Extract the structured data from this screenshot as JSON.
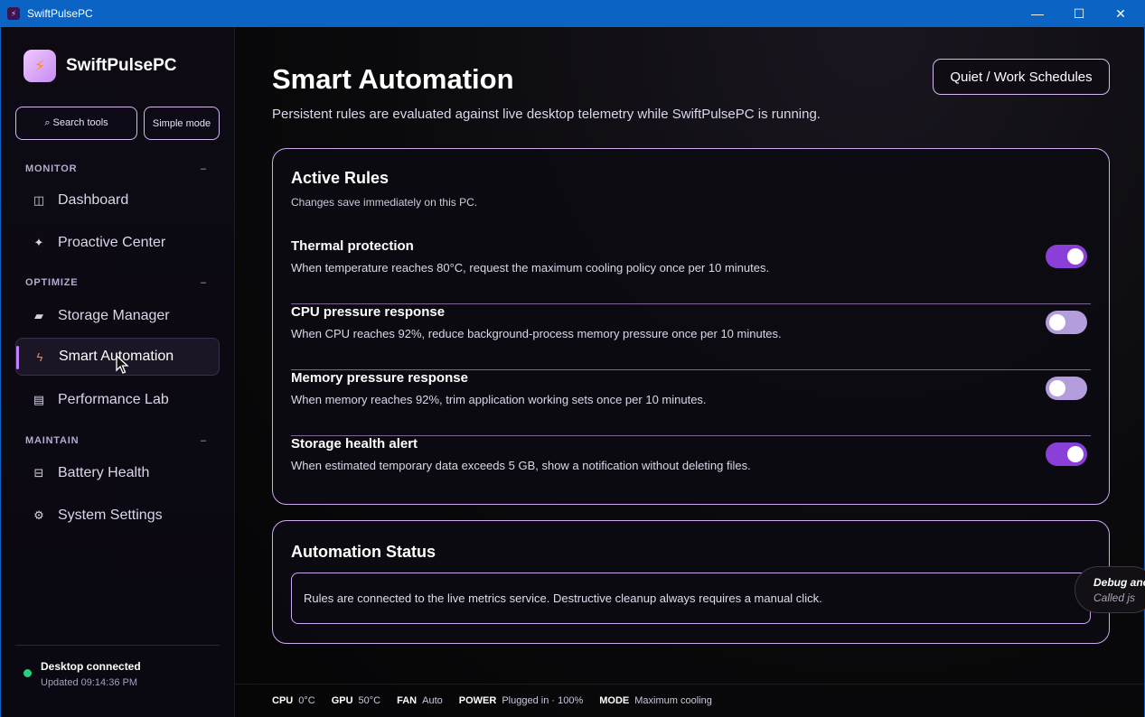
{
  "window": {
    "title": "SwiftPulsePC",
    "app_icon": "app-icon",
    "minimize_glyph": "—",
    "maximize_glyph": "☐",
    "close_glyph": "✕"
  },
  "sidebar": {
    "brand_name": "SwiftPulsePC",
    "brand_icon": "⚡",
    "search_label": "⌕ Search tools",
    "simple_mode_label": "Simple mode",
    "sections": [
      {
        "label": "MONITOR",
        "collapse": "–"
      },
      {
        "label": "OPTIMIZE",
        "collapse": "–"
      },
      {
        "label": "MAINTAIN",
        "collapse": "–"
      }
    ],
    "items": [
      {
        "label": "Dashboard",
        "icon": "◫"
      },
      {
        "label": "Proactive Center",
        "icon": "✦"
      },
      {
        "label": "Storage Manager",
        "icon": "▰"
      },
      {
        "label": "Smart Automation",
        "icon": "ϟ"
      },
      {
        "label": "Performance Lab",
        "icon": "▤"
      },
      {
        "label": "Battery Health",
        "icon": "⊟"
      },
      {
        "label": "System Settings",
        "icon": "⚙"
      }
    ],
    "connection": {
      "title": "Desktop connected",
      "updated": "Updated 09:14:36 PM",
      "status_color": "#22d37a"
    }
  },
  "header": {
    "title": "Smart Automation",
    "subtitle": "Persistent rules are evaluated against live desktop telemetry while SwiftPulsePC is running.",
    "schedules_button": "Quiet / Work Schedules"
  },
  "active_rules": {
    "title": "Active Rules",
    "subtitle": "Changes save immediately on this PC.",
    "rules": [
      {
        "title": "Thermal protection",
        "description": "When temperature reaches 80°C, request the maximum cooling policy once per 10 minutes.",
        "enabled": true
      },
      {
        "title": "CPU pressure response",
        "description": "When CPU reaches 92%, reduce background-process memory pressure once per 10 minutes.",
        "enabled": false
      },
      {
        "title": "Memory pressure response",
        "description": "When memory reaches 92%, trim application working sets once per 10 minutes.",
        "enabled": false
      },
      {
        "title": "Storage health alert",
        "description": "When estimated temporary data exceeds 5 GB, show a notification without deleting files.",
        "enabled": true
      }
    ]
  },
  "automation_status": {
    "title": "Automation Status",
    "message": "Rules are connected to the live metrics service. Destructive cleanup always requires a manual click."
  },
  "statusbar": {
    "cpu_label": "CPU",
    "cpu_value": "0°C",
    "gpu_label": "GPU",
    "gpu_value": "50°C",
    "fan_label": "FAN",
    "fan_value": "Auto",
    "power_label": "POWER",
    "power_value": "Plugged in · 100%",
    "mode_label": "MODE",
    "mode_value": "Maximum cooling"
  },
  "debug_overlay": {
    "title": "Debug anc",
    "subtitle": "Called js"
  },
  "colors": {
    "accent": "#8a3fd8",
    "border": "#cfa9f0",
    "titlebar": "#0b63c4",
    "active_icon": "#ff8a2a"
  }
}
